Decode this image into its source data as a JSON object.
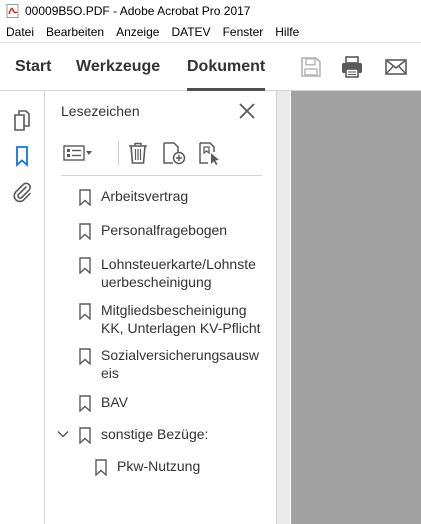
{
  "window": {
    "title": "00009B5O.PDF - Adobe Acrobat Pro 2017"
  },
  "menu": [
    "Datei",
    "Bearbeiten",
    "Anzeige",
    "DATEV",
    "Fenster",
    "Hilfe"
  ],
  "tabs": [
    {
      "label": "Start",
      "active": false
    },
    {
      "label": "Werkzeuge",
      "active": false
    },
    {
      "label": "Dokument",
      "active": true
    }
  ],
  "toolbar_icons": [
    "save-icon",
    "print-icon",
    "mail-icon"
  ],
  "rail_icons": [
    "pages-icon",
    "bookmark-icon",
    "attachment-icon"
  ],
  "panel": {
    "title": "Lesezeichen",
    "toolbar_icons": [
      "options-icon",
      "delete-icon",
      "new-bookmark-icon",
      "bookmark-from-structure-icon"
    ]
  },
  "bookmarks": [
    {
      "label": "Arbeitsvertrag",
      "level": 0
    },
    {
      "label": "Personalfragebogen",
      "level": 0
    },
    {
      "label": "Lohnsteuerkarte/Lohnste\nuerbescheinigung",
      "level": 0
    },
    {
      "label": "Mitgliedsbescheinigung\nKK, Unterlagen KV-Pflicht",
      "level": 0
    },
    {
      "label": "Sozialversicherungsausw\neis",
      "level": 0
    },
    {
      "label": "BAV",
      "level": 0
    },
    {
      "label": "sonstige Bezüge:",
      "level": 0,
      "expanded": true
    },
    {
      "label": "Pkw-Nutzung",
      "level": 1
    }
  ],
  "colors": {
    "accent": "#1473e6",
    "icon": "#5a5a5a",
    "doc_background": "#a2a2a2"
  }
}
